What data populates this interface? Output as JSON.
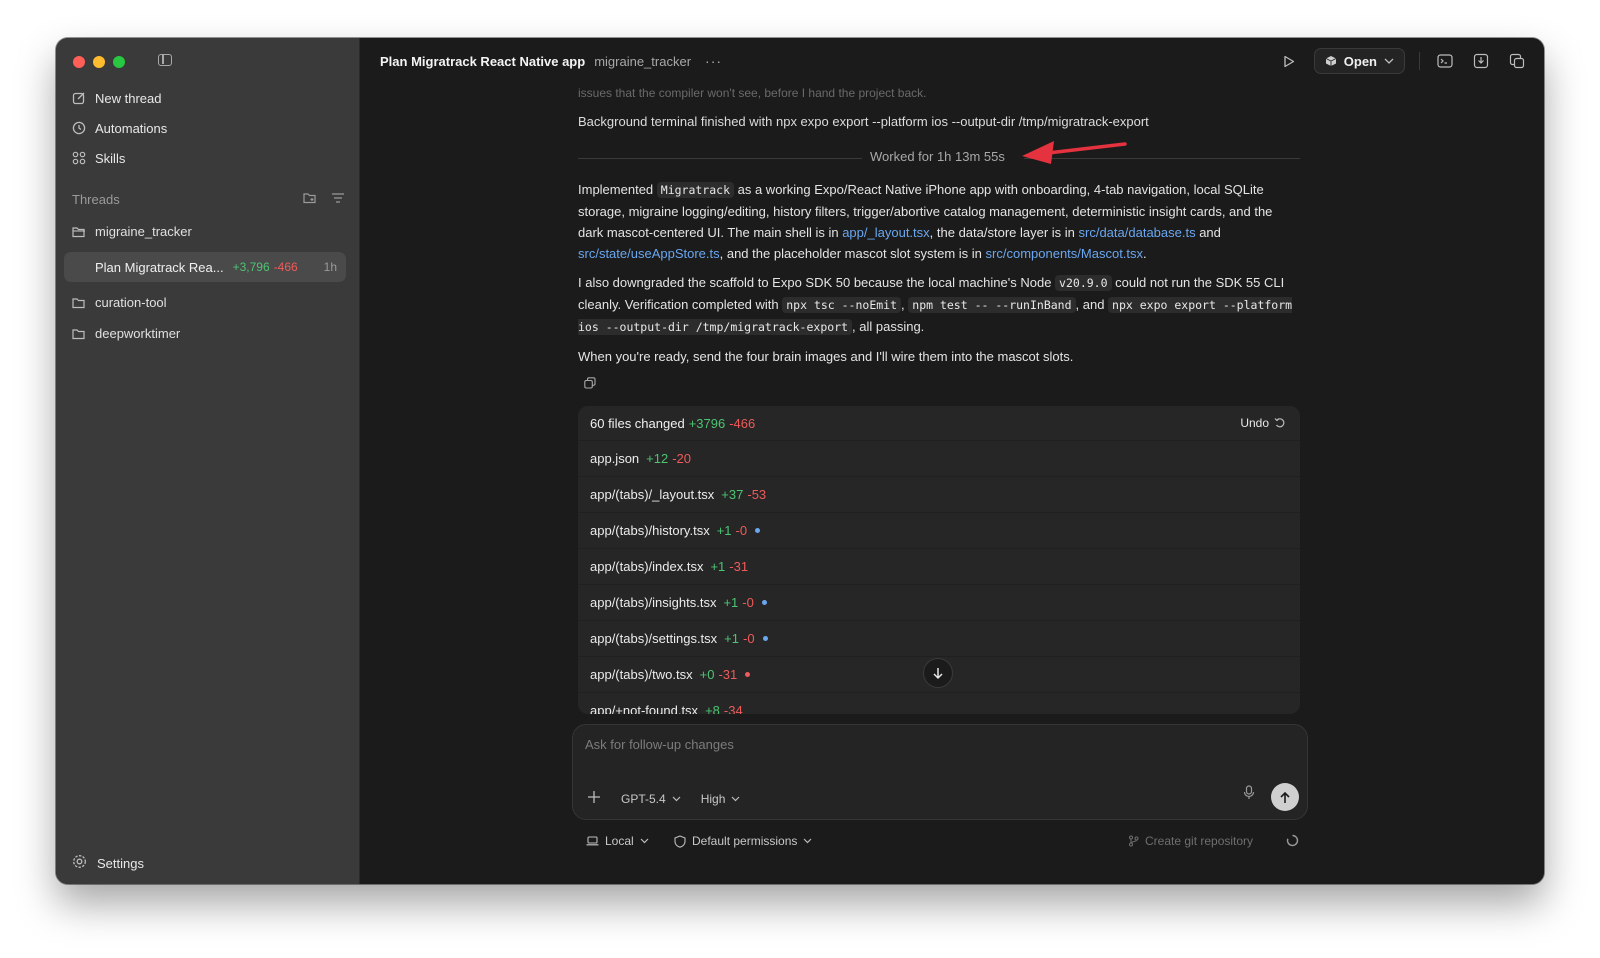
{
  "app": {
    "title": "Plan Migratrack React Native app",
    "subtitle": "migraine_tracker",
    "more": "···",
    "open_label": "Open"
  },
  "sidebar": {
    "nav": [
      {
        "label": "New thread",
        "icon": "edit-icon"
      },
      {
        "label": "Automations",
        "icon": "clock-icon"
      },
      {
        "label": "Skills",
        "icon": "grid-icon"
      }
    ],
    "threads_header": "Threads",
    "folders": [
      {
        "label": "migraine_tracker"
      },
      {
        "label": "curation-tool"
      },
      {
        "label": "deepworktimer"
      }
    ],
    "active_thread": {
      "label": "Plan Migratrack Rea...",
      "additions": "+3,796",
      "deletions": "-466",
      "age": "1h"
    },
    "settings_label": "Settings"
  },
  "conversation": {
    "faded_text": "issues that the compiler won't see, before I hand the project back.",
    "background_terminal": "Background terminal finished with npx expo export --platform ios --output-dir /tmp/migratrack-export",
    "worked_for": "Worked for 1h 13m 55s",
    "p1": {
      "a": "Implemented ",
      "code1": "Migratrack",
      "b": " as a working Expo/React Native iPhone app with onboarding, 4-tab navigation, local SQLite storage, migraine logging/editing, history filters, trigger/abortive catalog management, deterministic insight cards, and the dark mascot-centered UI. The main shell is in ",
      "link1": "app/_layout.tsx",
      "c": ", the data/store layer is in ",
      "link2": "src/data/database.ts",
      "d": " and ",
      "link3": "src/state/useAppStore.ts",
      "e": ", and the placeholder mascot slot system is in ",
      "link4": "src/components/Mascot.tsx",
      "f": "."
    },
    "p2": {
      "a": "I also downgraded the scaffold to Expo SDK 50 because the local machine's Node ",
      "code1": "v20.9.0",
      "b": " could not run the SDK 55 CLI cleanly. Verification completed with ",
      "code2": "npx tsc --noEmit",
      "c": ", ",
      "code3": "npm test -- --runInBand",
      "d": ", and ",
      "code4": "npx expo export --platform ios --output-dir /tmp/migratrack-export",
      "e": ", all passing."
    },
    "p3": "When you're ready, send the four brain images and I'll wire them into the mascot slots."
  },
  "changes": {
    "summary": "60 files changed",
    "additions": "+3796",
    "deletions": "-466",
    "undo_label": "Undo",
    "files": [
      {
        "name": "app.json",
        "add": "+12",
        "del": "-20",
        "dot": ""
      },
      {
        "name": "app/(tabs)/_layout.tsx",
        "add": "+37",
        "del": "-53",
        "dot": ""
      },
      {
        "name": "app/(tabs)/history.tsx",
        "add": "+1",
        "del": "-0",
        "dot": "#6aa7f0"
      },
      {
        "name": "app/(tabs)/index.tsx",
        "add": "+1",
        "del": "-31",
        "dot": ""
      },
      {
        "name": "app/(tabs)/insights.tsx",
        "add": "+1",
        "del": "-0",
        "dot": "#6aa7f0"
      },
      {
        "name": "app/(tabs)/settings.tsx",
        "add": "+1",
        "del": "-0",
        "dot": "#6aa7f0"
      },
      {
        "name": "app/(tabs)/two.tsx",
        "add": "+0",
        "del": "-31",
        "dot": "#ef5a5a"
      },
      {
        "name": "app/+not-found.tsx",
        "add": "+8",
        "del": "-34",
        "dot": ""
      }
    ]
  },
  "composer": {
    "placeholder": "Ask for follow-up changes",
    "model": "GPT-5.4",
    "effort": "High"
  },
  "footer": {
    "local": "Local",
    "permissions": "Default permissions",
    "git": "Create git repository"
  },
  "colors": {
    "accent_link": "#6aa7f0",
    "additions": "#4cc472",
    "deletions": "#ef5a5a",
    "annotation_arrow": "#e5323f"
  }
}
